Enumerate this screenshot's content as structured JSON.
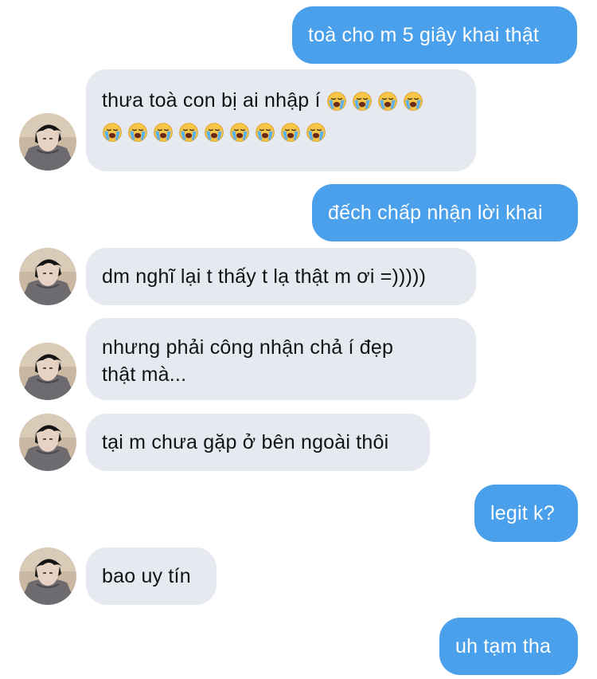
{
  "messages": [
    {
      "side": "out",
      "text": "toà cho m 5 giây khai thật"
    },
    {
      "side": "in",
      "text": "thưa toà con bị ai nhập í",
      "emoji": "loudly-crying-face",
      "emoji_count_line1": 4,
      "emoji_count_line2": 9
    },
    {
      "side": "out",
      "text": "đếch chấp nhận lời khai"
    },
    {
      "side": "in",
      "text": "dm nghĩ lại t thấy t lạ thật m ơi =)))))"
    },
    {
      "side": "in",
      "text_line1": "nhưng phải công nhận chả í đẹp",
      "text_line2": "thật mà..."
    },
    {
      "side": "in",
      "text": "tại m chưa gặp ở bên ngoài thôi"
    },
    {
      "side": "out",
      "text": "legit k?"
    },
    {
      "side": "in",
      "text": "bao uy tín"
    },
    {
      "side": "out",
      "text": "uh tạm tha"
    }
  ],
  "colors": {
    "outgoing_bubble": "#4aa0ea",
    "incoming_bubble": "#e6e9ef",
    "emoji_face": "#f7c547",
    "emoji_tears": "#5fb1ee"
  }
}
